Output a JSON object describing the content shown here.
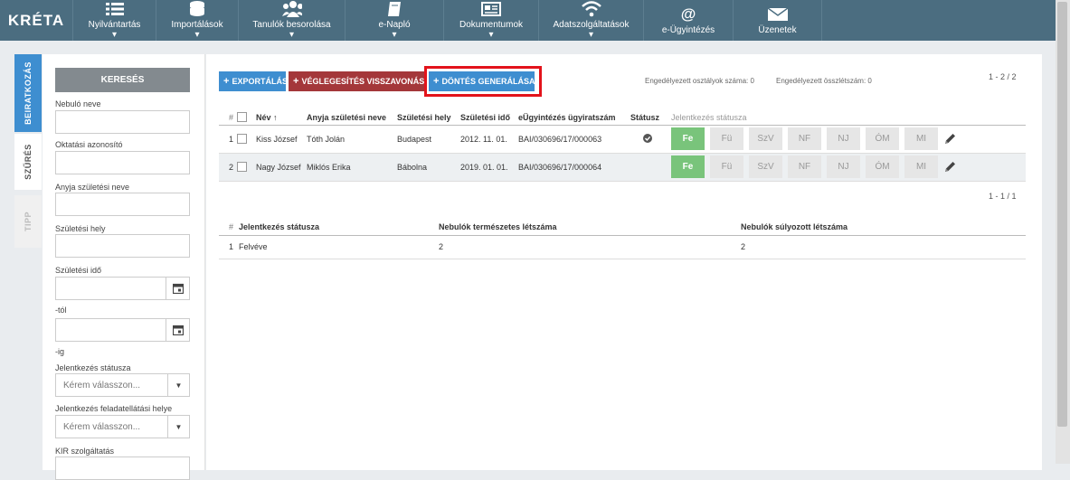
{
  "logo": "KRÉTA",
  "nav": [
    {
      "label": "Nyilvántartás",
      "icon": "list-icon"
    },
    {
      "label": "Importálások",
      "icon": "database-icon"
    },
    {
      "label": "Tanulók besorolása",
      "icon": "users-icon"
    },
    {
      "label": "e-Napló",
      "icon": "book-icon"
    },
    {
      "label": "Dokumentumok",
      "icon": "newspaper-icon"
    },
    {
      "label": "Adatszolgáltatások",
      "icon": "wifi-icon"
    },
    {
      "label": "e-Ügyintézés",
      "icon": "at-icon"
    },
    {
      "label": "Üzenetek",
      "icon": "envelope-icon"
    }
  ],
  "side_tabs": {
    "enrollment": "BEIRATKOZÁS",
    "filter": "SZŰRÉS",
    "tip": "TIPP"
  },
  "filter": {
    "search_button": "KERESÉS",
    "student_name": "Nebuló neve",
    "edu_id": "Oktatási azonosító",
    "mother_name": "Anyja születési neve",
    "birth_place": "Születési hely",
    "birth_date": "Születési idő",
    "from": "-tól",
    "to": "-ig",
    "status": "Jelentkezés státusza",
    "status_placeholder": "Kérem válasszon...",
    "task_place": "Jelentkezés feladatellátási helye",
    "task_place_placeholder": "Kérem válasszon...",
    "kir": "KIR szolgáltatás"
  },
  "toolbar": {
    "export": "EXPORTÁLÁS",
    "revoke": "VÉGLEGESÍTÉS VISSZAVONÁSA",
    "decision": "DÖNTÉS GENERÁLÁSA"
  },
  "stats": {
    "classes": "Engedélyezett osztályok száma: 0",
    "total": "Engedélyezett összlétszám: 0"
  },
  "pager_top": "1 - 2 / 2",
  "pager_mid": "1 - 1 / 1",
  "grid": {
    "headers": {
      "num": "#",
      "name": "Név ↑",
      "mother": "Anyja születési neve",
      "place": "Születési hely",
      "date": "Születési idő",
      "case": "eÜgyintézés ügyiratszám",
      "status": "Státusz",
      "enroll_status": "Jelentkezés státusza"
    },
    "status_buttons": [
      "Fe",
      "Fü",
      "SzV",
      "NF",
      "NJ",
      "ÓM",
      "MI"
    ],
    "rows": [
      {
        "num": "1",
        "name": "Kiss József",
        "mother": "Tóth Jolán",
        "place": "Budapest",
        "date": "2012. 11. 01.",
        "case": "BAI/030696/17/000063",
        "has_status_icon": true
      },
      {
        "num": "2",
        "name": "Nagy József",
        "mother": "Miklós Erika",
        "place": "Bábolna",
        "date": "2019. 01. 01.",
        "case": "BAI/030696/17/000064",
        "has_status_icon": false
      }
    ]
  },
  "summary": {
    "headers": {
      "num": "#",
      "status": "Jelentkezés státusza",
      "natural": "Nebulók természetes létszáma",
      "weighted": "Nebulók súlyozott létszáma"
    },
    "rows": [
      {
        "num": "1",
        "status": "Felvéve",
        "natural": "2",
        "weighted": "2"
      }
    ]
  }
}
